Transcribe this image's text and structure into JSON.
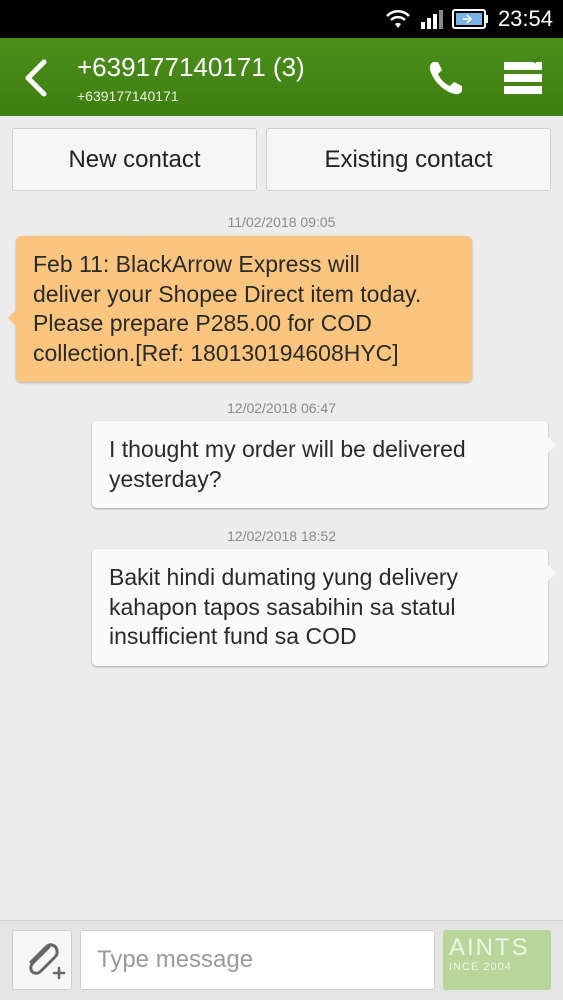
{
  "status_bar": {
    "time": "23:54"
  },
  "header": {
    "title": "+639177140171 (3)",
    "subtitle": "+639177140171"
  },
  "actions": {
    "new_contact": "New contact",
    "existing_contact": "Existing contact"
  },
  "messages": [
    {
      "timestamp": "11/02/2018 09:05",
      "direction": "incoming",
      "lines": [
        "Feb 11: BlackArrow Express will",
        "deliver your Shopee Direct item today.",
        "Please prepare P285.00 for COD",
        "collection.[Ref: 180130194608HYC]"
      ]
    },
    {
      "timestamp": "12/02/2018 06:47",
      "direction": "outgoing",
      "lines": [
        "I thought my order will be delivered",
        "yesterday?"
      ]
    },
    {
      "timestamp": "12/02/2018 18:52",
      "direction": "outgoing",
      "lines": [
        "Bakit hindi dumating yung delivery",
        "kahapon tapos sasabihin sa statul",
        "insufficient fund sa COD"
      ]
    }
  ],
  "composer": {
    "placeholder": "Type message",
    "watermark_line1": "AINTS",
    "watermark_line2": "INCE 2004"
  },
  "colors": {
    "header": "#3f7e12",
    "incoming_bubble": "#fcc57f",
    "outgoing_bubble": "#fafafa",
    "send_button": "#b9d69a"
  },
  "icons": [
    "wifi-icon",
    "signal-icon",
    "battery-icon",
    "back-arrow-icon",
    "phone-icon",
    "menu-icon",
    "paperclip-icon"
  ]
}
